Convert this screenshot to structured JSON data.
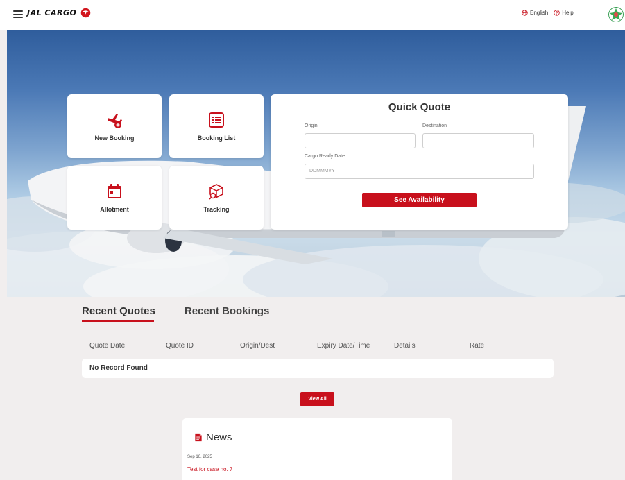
{
  "header": {
    "brand": "JAL CARGO",
    "language_label": "English",
    "help_label": "Help"
  },
  "tiles": {
    "new_booking": "New Booking",
    "booking_list": "Booking List",
    "allotment": "Allotment",
    "tracking": "Tracking"
  },
  "quick_quote": {
    "title": "Quick Quote",
    "origin_label": "Origin",
    "origin_value": "",
    "destination_label": "Destination",
    "destination_value": "",
    "cargo_ready_label": "Cargo Ready Date",
    "cargo_ready_placeholder": "DDMMMYY",
    "submit_label": "See Availability"
  },
  "tabs": {
    "recent_quotes": "Recent Quotes",
    "recent_bookings": "Recent Bookings"
  },
  "table": {
    "columns": [
      "Quote Date",
      "Quote ID",
      "Origin/Dest",
      "Expiry Date/Time",
      "Details",
      "Rate"
    ],
    "empty_text": "No Record Found"
  },
  "view_all_label": "View All",
  "news": {
    "title": "News",
    "items": [
      {
        "date": "Sep 16, 2025",
        "headline": "Test for case no. 7"
      }
    ]
  },
  "colors": {
    "accent": "#c8101c",
    "background": "#f1eeee"
  }
}
